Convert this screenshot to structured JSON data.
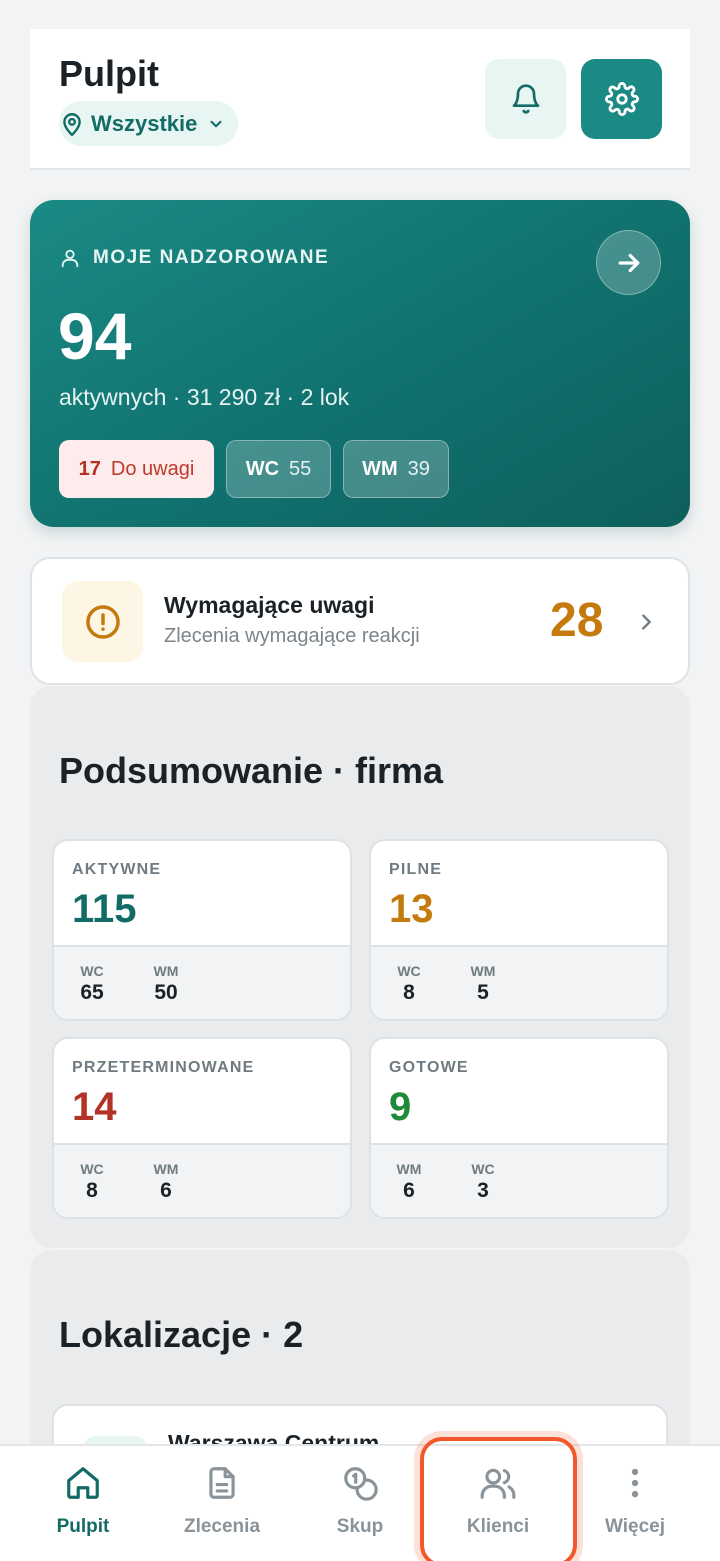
{
  "header": {
    "title": "Pulpit",
    "location_label": "Wszystkie"
  },
  "hero": {
    "label": "MOJE NADZOROWANE",
    "count": "94",
    "subtitle": "aktywnych · 31 290 zł · 2 lok",
    "chips": {
      "alert_count": "17",
      "alert_label": "Do uwagi",
      "wc_label": "WC",
      "wc_value": "55",
      "wm_label": "WM",
      "wm_value": "39"
    }
  },
  "attention": {
    "title": "Wymagające uwagi",
    "subtitle": "Zlecenia wymagające reakcji",
    "count": "28"
  },
  "summary": {
    "title": "Podsumowanie · firma",
    "cards": [
      {
        "label": "AKTYWNE",
        "value": "115",
        "subs": [
          {
            "k": "WC",
            "v": "65"
          },
          {
            "k": "WM",
            "v": "50"
          }
        ]
      },
      {
        "label": "PILNE",
        "value": "13",
        "subs": [
          {
            "k": "WC",
            "v": "8"
          },
          {
            "k": "WM",
            "v": "5"
          }
        ]
      },
      {
        "label": "PRZETERMINOWANE",
        "value": "14",
        "subs": [
          {
            "k": "WC",
            "v": "8"
          },
          {
            "k": "WM",
            "v": "6"
          }
        ]
      },
      {
        "label": "GOTOWE",
        "value": "9",
        "subs": [
          {
            "k": "WM",
            "v": "6"
          },
          {
            "k": "WC",
            "v": "3"
          }
        ]
      }
    ]
  },
  "locations": {
    "title": "Lokalizacje · 2",
    "items": [
      {
        "name": "Warszawa Centrum"
      }
    ]
  },
  "nav": {
    "items": [
      {
        "label": "Pulpit",
        "icon": "home-icon"
      },
      {
        "label": "Zlecenia",
        "icon": "document-icon"
      },
      {
        "label": "Skup",
        "icon": "coins-icon"
      },
      {
        "label": "Klienci",
        "icon": "users-icon"
      },
      {
        "label": "Więcej",
        "icon": "more-vertical-icon"
      }
    ]
  },
  "colors": {
    "primary": "#1b8a84",
    "primary_dark": "#0e5f5c",
    "alert": "#b33226",
    "warning": "#c57a0e",
    "success": "#1f8a3a",
    "highlight": "#f2582a"
  }
}
